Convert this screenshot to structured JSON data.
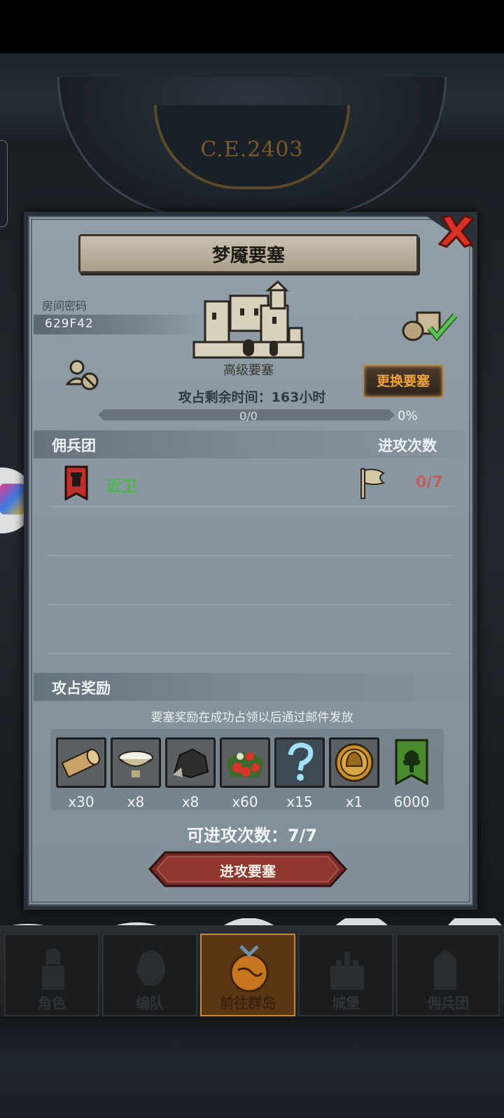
{
  "background": {
    "era_label": "C.E.2403"
  },
  "dialog": {
    "title": "梦魇要塞",
    "room_code_label": "房间密码",
    "room_code": "629F42",
    "fortress_level": "高级要塞",
    "change_button": "更换要塞",
    "remaining_time_label": "攻占剩余时间：",
    "remaining_time_value": "163小时",
    "progress": {
      "count_text": "0/0",
      "percent_text": "0%",
      "fraction": 0
    },
    "mercenary_section": {
      "title": "佣兵团",
      "attack_count_header": "进攻次数",
      "entries": [
        {
          "name": "近卫",
          "attacks": "0/7"
        }
      ]
    },
    "reward_section": {
      "title": "攻占奖励",
      "note": "要塞奖励在成功占领以后通过邮件发放",
      "items": [
        {
          "icon": "wood-log-icon",
          "qty": "x30"
        },
        {
          "icon": "porcelain-bowl-icon",
          "qty": "x8"
        },
        {
          "icon": "ore-stone-icon",
          "qty": "x8"
        },
        {
          "icon": "berries-icon",
          "qty": "x60"
        },
        {
          "icon": "mystery-question-icon",
          "qty": "x15"
        },
        {
          "icon": "knight-helmet-coin-icon",
          "qty": "x1"
        },
        {
          "icon": "tree-banner-icon",
          "qty": "6000"
        }
      ]
    },
    "attempts_label": "可进攻次数：",
    "attempts_value": "7/7",
    "attack_button": "进攻要塞"
  },
  "bottom_nav": {
    "items": [
      {
        "label": "角色",
        "icon": "knight-icon"
      },
      {
        "label": "编队",
        "icon": "helmet-icon"
      },
      {
        "label": "前往群岛",
        "icon": "globe-icon",
        "active": true
      },
      {
        "label": "城堡",
        "icon": "castle-icon"
      },
      {
        "label": "佣兵团",
        "icon": "mercenary-icon"
      }
    ]
  },
  "colors": {
    "accent_orange": "#f0a33c",
    "guild_green": "#4cb84a",
    "attack_red": "#c45a5a",
    "dialog_gray": "#8997a2"
  }
}
